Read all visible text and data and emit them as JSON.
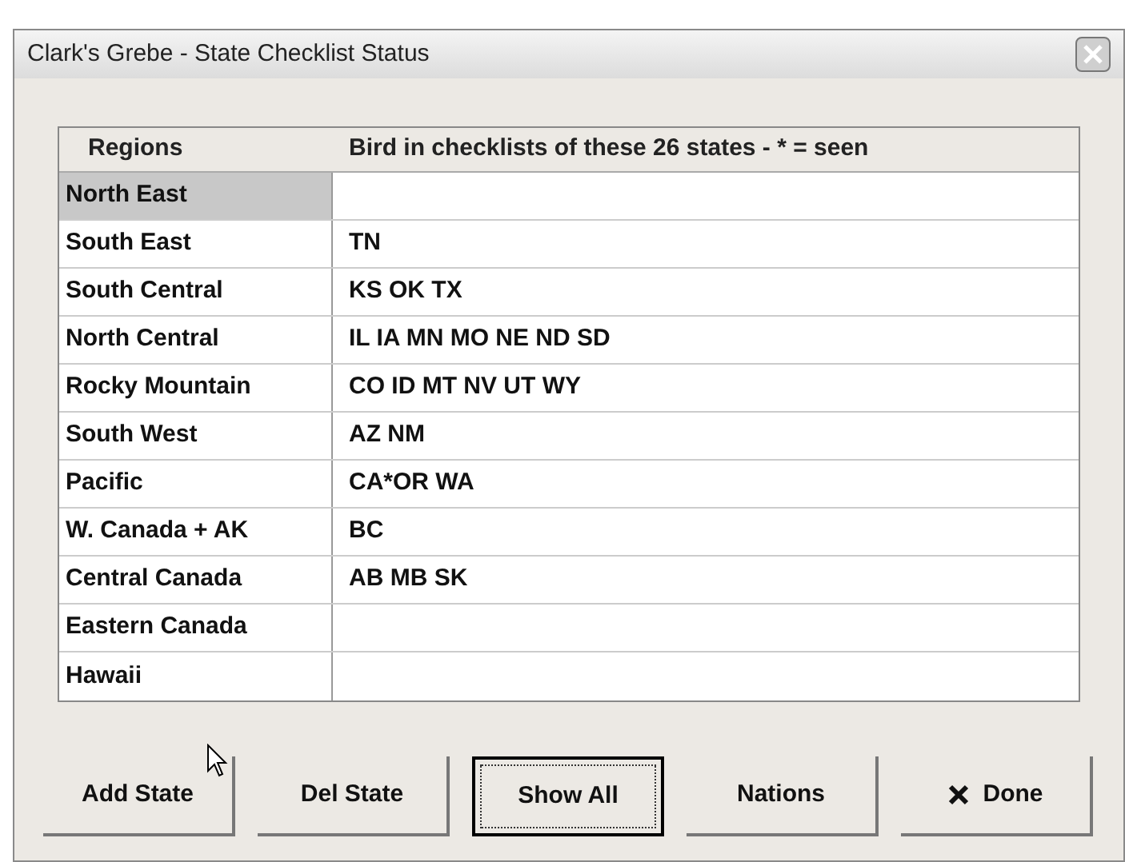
{
  "window": {
    "title": "Clark's Grebe  -  State Checklist Status"
  },
  "table": {
    "columns": [
      "Regions",
      "Bird in checklists of these 26 states - * = seen"
    ],
    "rows": [
      {
        "region": "North East",
        "states": "",
        "selected": true
      },
      {
        "region": "South East",
        "states": "TN",
        "selected": false
      },
      {
        "region": "South Central",
        "states": "KS OK TX",
        "selected": false
      },
      {
        "region": "North Central",
        "states": "IL IA MN MO NE ND SD",
        "selected": false
      },
      {
        "region": "Rocky Mountain",
        "states": "CO ID MT NV UT WY",
        "selected": false
      },
      {
        "region": "South West",
        "states": "AZ NM",
        "selected": false
      },
      {
        "region": "Pacific",
        "states": "CA*OR WA",
        "selected": false
      },
      {
        "region": "W. Canada + AK",
        "states": "BC",
        "selected": false
      },
      {
        "region": "Central Canada",
        "states": "AB MB SK",
        "selected": false
      },
      {
        "region": "Eastern Canada",
        "states": "",
        "selected": false
      },
      {
        "region": "Hawaii",
        "states": "",
        "selected": false
      }
    ]
  },
  "buttons": [
    {
      "label": "Add State",
      "kind": "plain",
      "focused": false
    },
    {
      "label": "Del State",
      "kind": "plain",
      "focused": false
    },
    {
      "label": "Show All",
      "kind": "plain",
      "focused": true
    },
    {
      "label": "Nations",
      "kind": "plain",
      "focused": false
    },
    {
      "label": "Done",
      "kind": "close",
      "focused": false
    }
  ]
}
